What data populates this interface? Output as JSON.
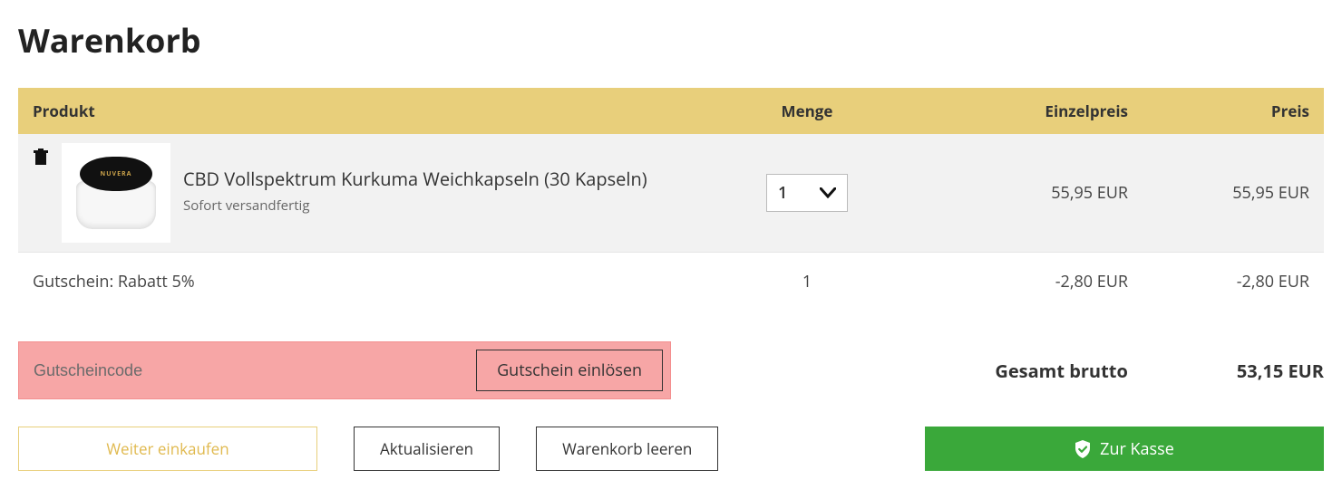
{
  "title": "Warenkorb",
  "columns": {
    "product": "Produkt",
    "qty": "Menge",
    "unit_price": "Einzelpreis",
    "price": "Preis"
  },
  "product": {
    "brand": "NUVERA",
    "name": "CBD Vollspektrum Kurkuma Weichkapseln (30 Kapseln)",
    "stock": "Sofort versandfertig",
    "qty": "1",
    "unit_price": "55,95 EUR",
    "price": "55,95 EUR"
  },
  "coupon_line": {
    "label": "Gutschein: Rabatt 5%",
    "qty": "1",
    "unit_price": "-2,80 EUR",
    "price": "-2,80 EUR"
  },
  "coupon": {
    "placeholder": "Gutscheincode",
    "button": "Gutschein einlösen"
  },
  "totals": {
    "label": "Gesamt brutto",
    "value": "53,15 EUR"
  },
  "actions": {
    "continue": "Weiter einkaufen",
    "update": "Aktualisieren",
    "clear": "Warenkorb leeren",
    "checkout": "Zur Kasse"
  }
}
